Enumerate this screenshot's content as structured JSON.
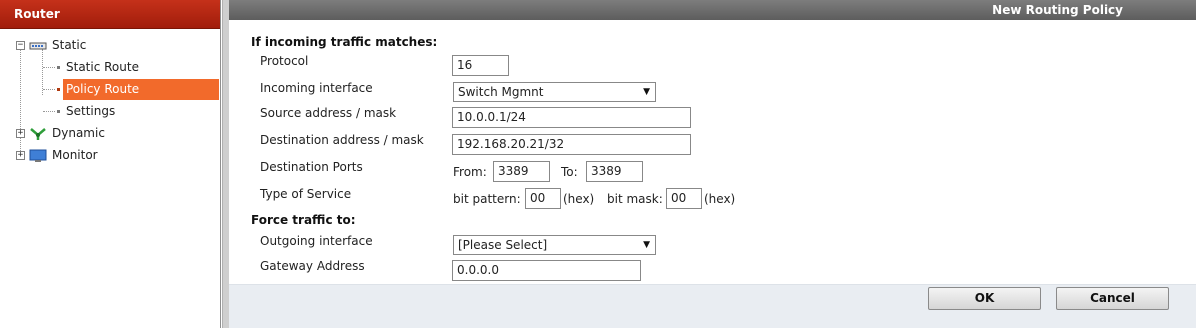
{
  "sidebar": {
    "title": "Router",
    "items": [
      {
        "label": "Static",
        "expander": "−",
        "icon": "network-switch-icon"
      },
      {
        "label": "Static Route"
      },
      {
        "label": "Policy Route",
        "selected": true
      },
      {
        "label": "Settings"
      },
      {
        "label": "Dynamic",
        "expander": "+",
        "icon": "dynamic-routing-icon"
      },
      {
        "label": "Monitor",
        "expander": "+",
        "icon": "monitor-icon"
      }
    ]
  },
  "header": {
    "title": "New Routing Policy"
  },
  "form": {
    "match_section_title": "If incoming traffic matches:",
    "protocol": {
      "label": "Protocol",
      "value": "16"
    },
    "incoming_interface": {
      "label": "Incoming interface",
      "value": "Switch Mgmnt"
    },
    "source": {
      "label": "Source address / mask",
      "value": "10.0.0.1/24"
    },
    "destination": {
      "label": "Destination address / mask",
      "value": "192.168.20.21/32"
    },
    "ports": {
      "label": "Destination Ports",
      "from_label": "From:",
      "from_value": "3389",
      "to_label": "To:",
      "to_value": "3389"
    },
    "tos": {
      "label": "Type of Service",
      "pattern_label": "bit pattern:",
      "pattern_value": "00",
      "hex1": "(hex)",
      "mask_label": "bit mask:",
      "mask_value": "00",
      "hex2": "(hex)"
    },
    "force_section_title": "Force traffic to:",
    "outgoing_interface": {
      "label": "Outgoing interface",
      "value": "[Please Select]"
    },
    "gateway": {
      "label": "Gateway Address",
      "value": "0.0.0.0"
    }
  },
  "buttons": {
    "ok": "OK",
    "cancel": "Cancel"
  },
  "colors": {
    "sidebar_header": "#b4250f",
    "selected": "#f26a2b",
    "main_header": "#6d6d6d",
    "footer": "#e9edf2"
  }
}
